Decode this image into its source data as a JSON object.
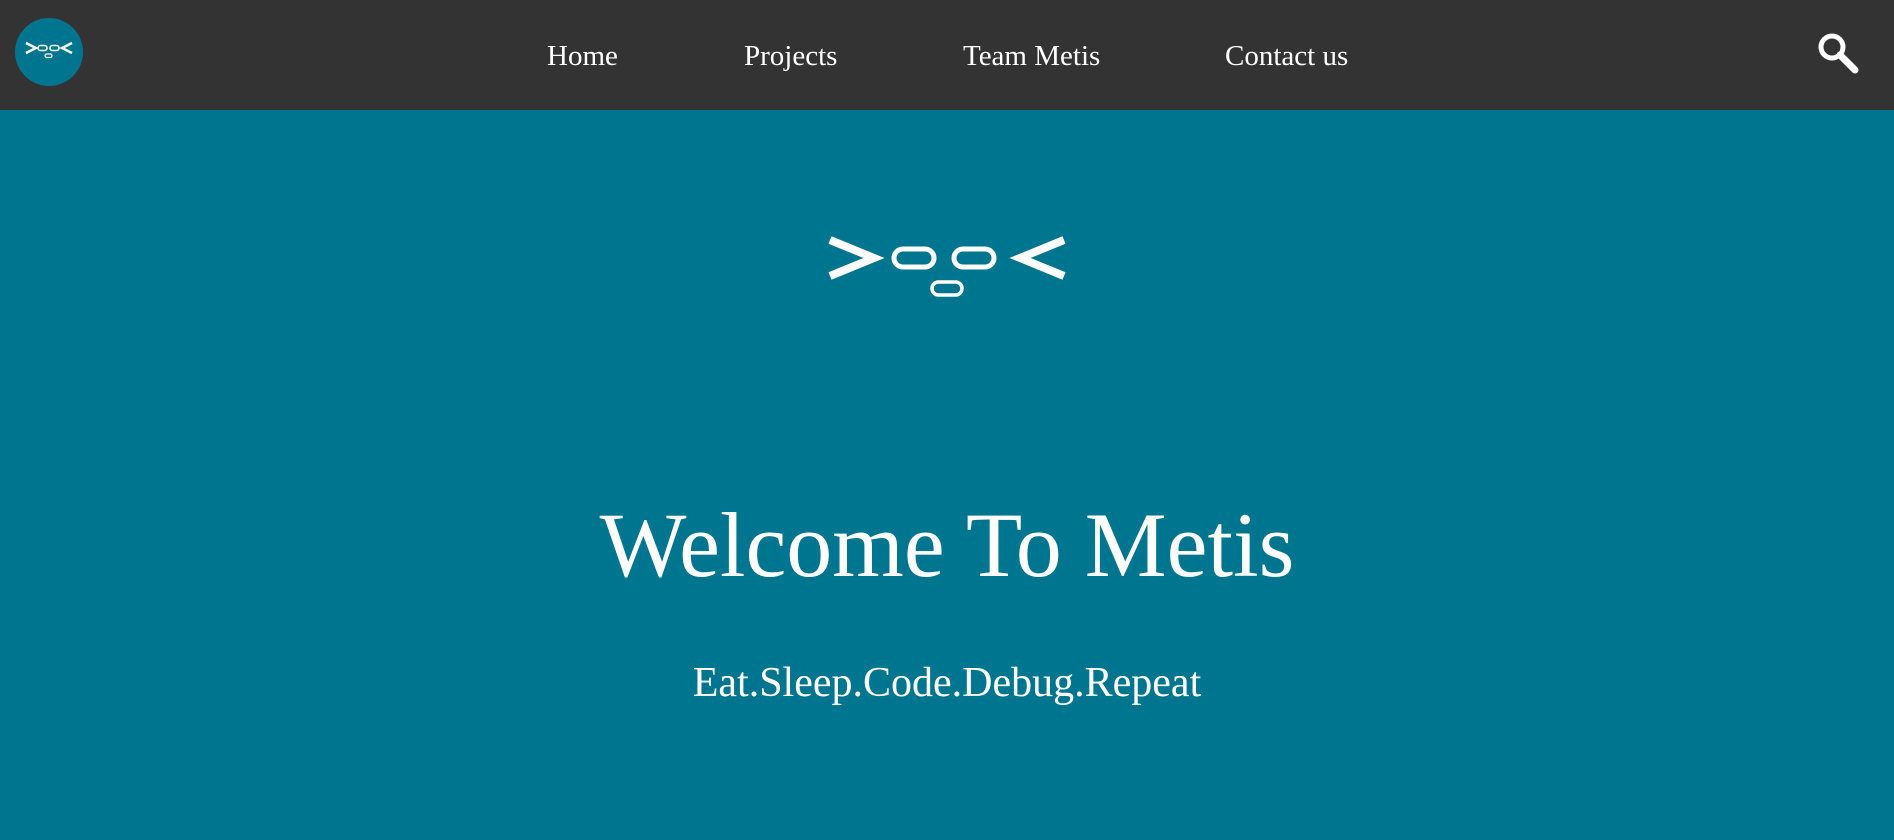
{
  "nav": {
    "logo_icon": "metis-face-logo-icon",
    "links": [
      {
        "label": "Home"
      },
      {
        "label": "Projects"
      },
      {
        "label": "Team Metis"
      },
      {
        "label": "Contact us"
      }
    ],
    "search_icon": "search-icon"
  },
  "hero": {
    "logo_icon": "metis-face-logo-icon",
    "title": "Welcome To Metis",
    "tagline": "Eat.Sleep.Code.Debug.Repeat"
  },
  "colors": {
    "navbar_bg": "#333333",
    "accent_teal": "#00758f",
    "text": "#ffffff"
  }
}
